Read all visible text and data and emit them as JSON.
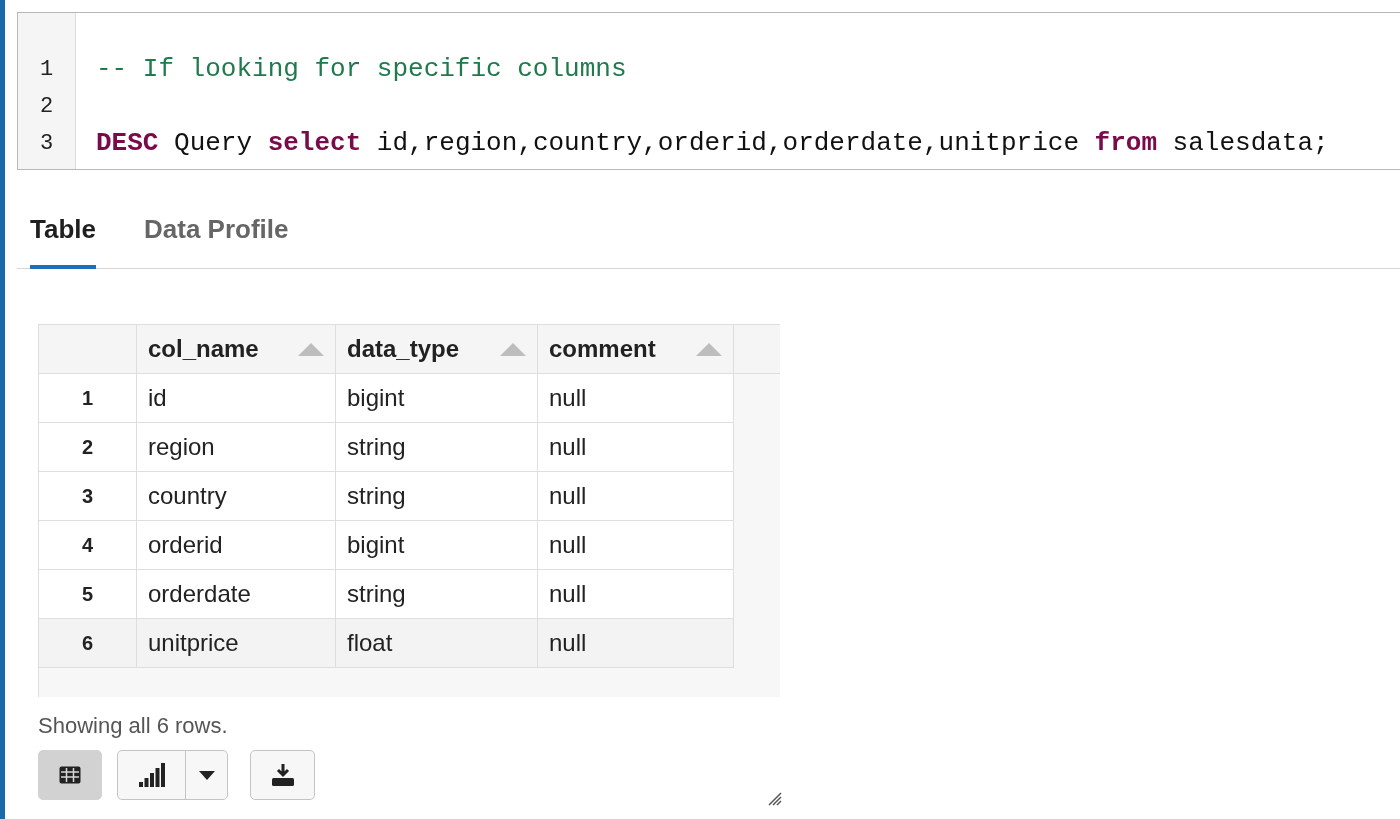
{
  "editor": {
    "lines": [
      {
        "number": "1",
        "tokens": [
          {
            "kind": "comment",
            "text": "-- If looking for specific columns"
          }
        ]
      },
      {
        "number": "2"
      },
      {
        "number": "3",
        "tokens": [
          {
            "kind": "keyword",
            "text": "DESC"
          },
          {
            "kind": "plain",
            "text": " Query "
          },
          {
            "kind": "keyword",
            "text": "select"
          },
          {
            "kind": "plain",
            "text": " id,region,country,orderid,orderdate,unitprice "
          },
          {
            "kind": "keyword",
            "text": "from"
          },
          {
            "kind": "plain",
            "text": " salesdata;"
          }
        ]
      }
    ]
  },
  "tabs": [
    {
      "label": "Table",
      "selected": true
    },
    {
      "label": "Data Profile",
      "selected": false
    }
  ],
  "table": {
    "columns": [
      "col_name",
      "data_type",
      "comment"
    ],
    "rows": [
      {
        "index": "1",
        "cells": [
          "id",
          "bigint",
          "null"
        ],
        "hovered": false
      },
      {
        "index": "2",
        "cells": [
          "region",
          "string",
          "null"
        ],
        "hovered": false
      },
      {
        "index": "3",
        "cells": [
          "country",
          "string",
          "null"
        ],
        "hovered": false
      },
      {
        "index": "4",
        "cells": [
          "orderid",
          "bigint",
          "null"
        ],
        "hovered": false
      },
      {
        "index": "5",
        "cells": [
          "orderdate",
          "string",
          "null"
        ],
        "hovered": false
      },
      {
        "index": "6",
        "cells": [
          "unitprice",
          "float",
          "null"
        ],
        "hovered": true
      }
    ]
  },
  "status": "Showing all 6 rows.",
  "view_buttons": [
    {
      "kind": "table",
      "selected": true
    },
    {
      "kind": "chart",
      "selected": false
    }
  ]
}
